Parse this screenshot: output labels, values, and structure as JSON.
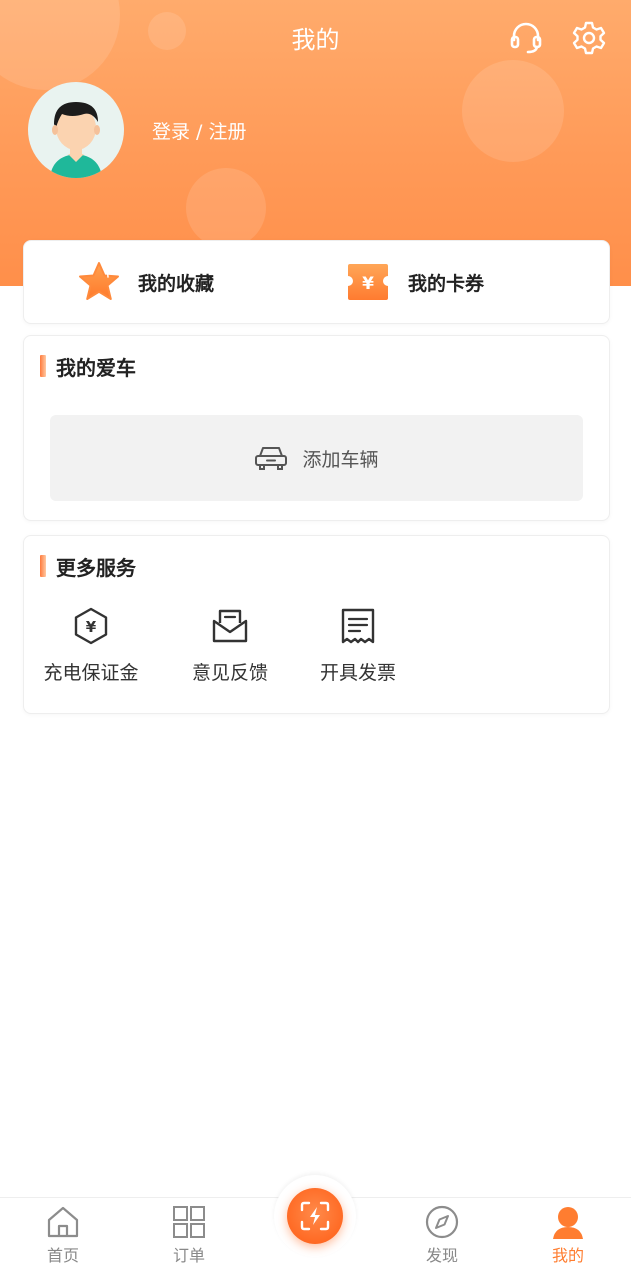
{
  "header": {
    "title": "我的",
    "login_text": "登录 / 注册"
  },
  "quick": {
    "favorites": "我的收藏",
    "coupons": "我的卡券"
  },
  "car_section": {
    "title": "我的爱车",
    "add_label": "添加车辆"
  },
  "services": {
    "title": "更多服务",
    "items": [
      {
        "label": "充电保证金",
        "icon": "yuan-hexagon-icon"
      },
      {
        "label": "意见反馈",
        "icon": "feedback-mail-icon"
      },
      {
        "label": "开具发票",
        "icon": "invoice-receipt-icon"
      }
    ]
  },
  "tabbar": {
    "home": "首页",
    "orders": "订单",
    "discover": "发现",
    "mine": "我的",
    "active": "mine"
  },
  "colors": {
    "accent": "#ff7d30",
    "header_top": "#ffab6c",
    "header_bottom": "#ff8f4a"
  }
}
